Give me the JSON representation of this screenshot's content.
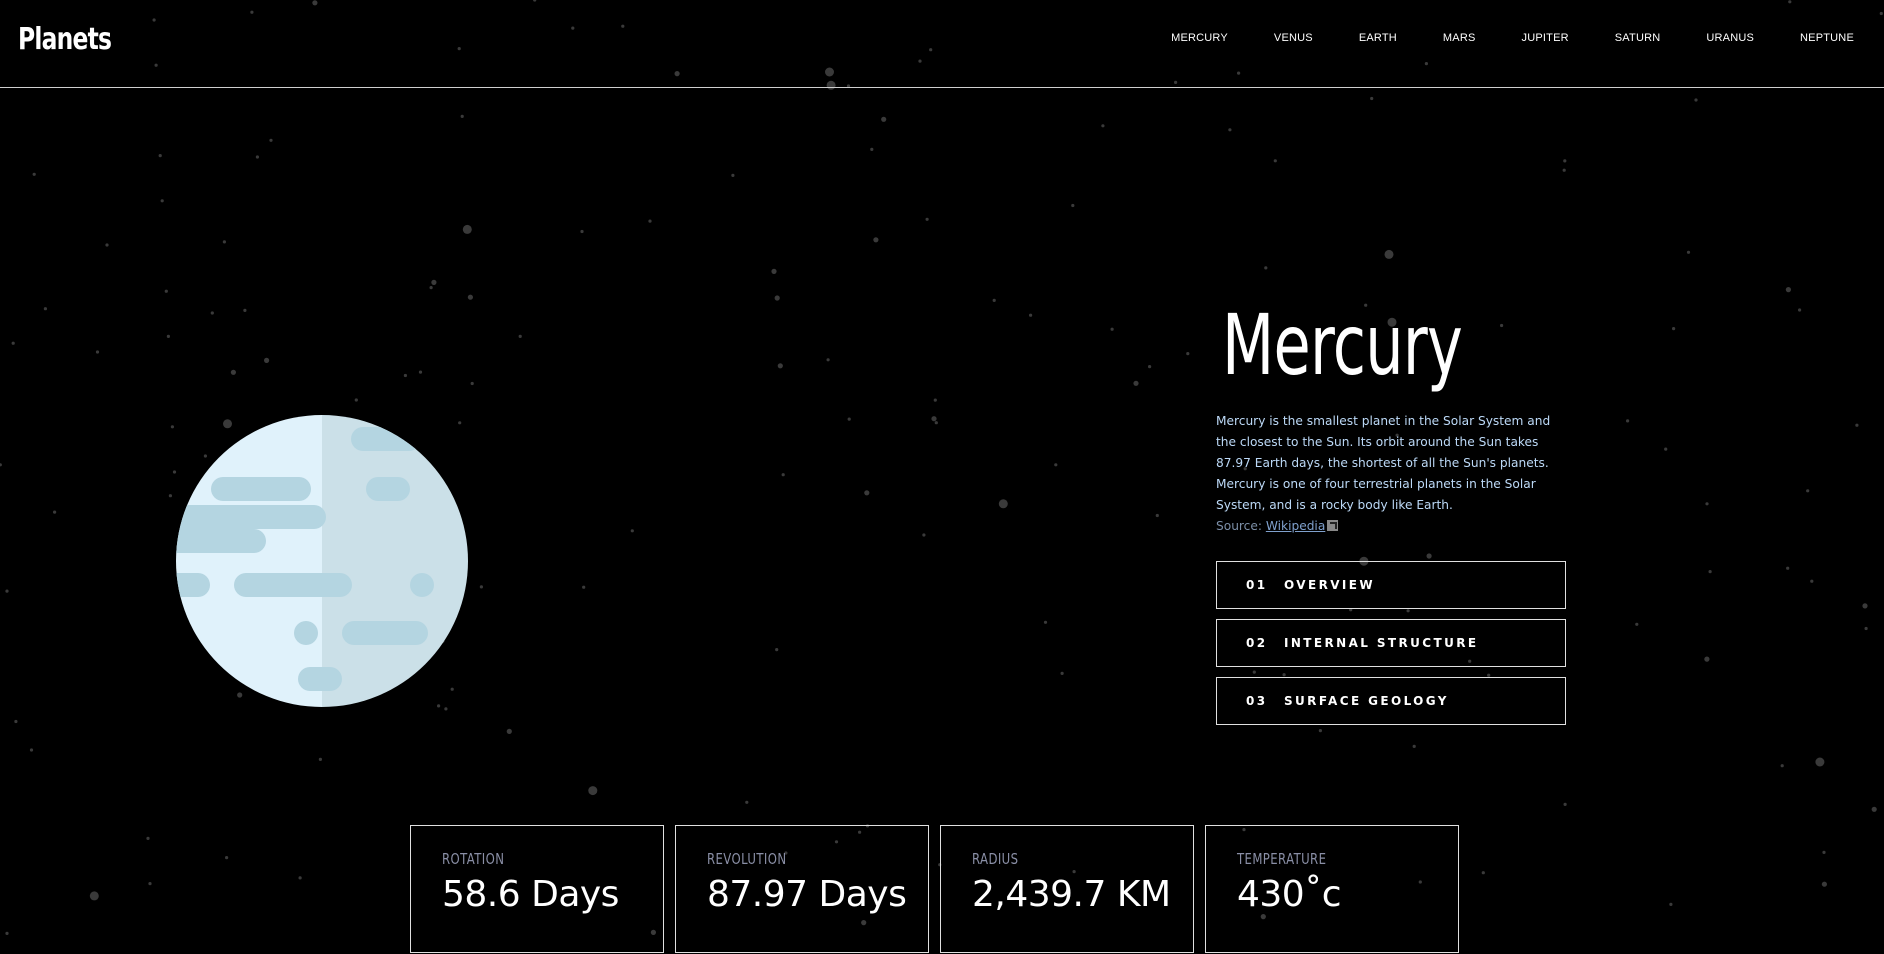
{
  "app": {
    "logo": "Planets"
  },
  "nav": {
    "items": [
      {
        "label": "MERCURY"
      },
      {
        "label": "VENUS"
      },
      {
        "label": "EARTH"
      },
      {
        "label": "MARS"
      },
      {
        "label": "JUPITER"
      },
      {
        "label": "SATURN"
      },
      {
        "label": "URANUS"
      },
      {
        "label": "NEPTUNE"
      }
    ]
  },
  "planet": {
    "name": "Mercury",
    "description": "Mercury is the smallest planet in the Solar System and the closest to the Sun. Its orbit around the Sun takes 87.97 Earth days, the shortest of all the Sun's planets. Mercury is one of four terrestrial planets in the Solar System, and is a rocky body like Earth.",
    "source_prefix": "Source: ",
    "source_link": "Wikipedia",
    "external_icon": "external-link-icon",
    "illustration_icon": "planet-mercury-icon"
  },
  "tabs": [
    {
      "num": "01",
      "label": "OVERVIEW"
    },
    {
      "num": "02",
      "label": "INTERNAL STRUCTURE"
    },
    {
      "num": "03",
      "label": "SURFACE GEOLOGY"
    }
  ],
  "stats": [
    {
      "label": "ROTATION",
      "value": "58.6 Days"
    },
    {
      "label": "REVOLUTION",
      "value": "87.97 Days"
    },
    {
      "label": "RADIUS",
      "value": "2,439.7 KM"
    },
    {
      "label": "TEMPERATURE",
      "value": "430˚c"
    }
  ],
  "colors": {
    "background": "#000000",
    "description_text": "#bcd9f7",
    "planet_light": "#e0f2fb",
    "planet_shadow": "#cbe0e8",
    "planet_spots": "#b4d5e1"
  }
}
